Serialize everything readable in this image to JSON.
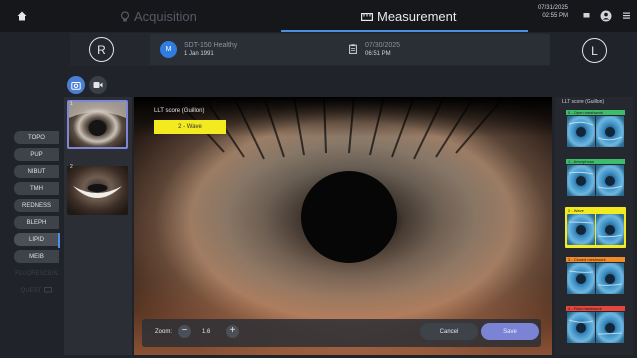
{
  "topbar": {
    "tab_acquisition": "Acquisition",
    "tab_measurement": "Measurement",
    "date": "07/31/2025",
    "time": "02:55 PM"
  },
  "patient": {
    "left_eye_letter": "R",
    "right_eye_letter": "L",
    "avatar_letter": "M",
    "name": "SDT-150 Healthy",
    "dob": "1 Jan 1991",
    "session_date": "07/30/2025",
    "session_time": "06:51 PM"
  },
  "nav": {
    "items": [
      {
        "label": "TOPO",
        "state": "normal"
      },
      {
        "label": "PUP",
        "state": "normal"
      },
      {
        "label": "NIBUT",
        "state": "normal"
      },
      {
        "label": "TMH",
        "state": "normal"
      },
      {
        "label": "REDNESS",
        "state": "normal"
      },
      {
        "label": "BLEPH",
        "state": "normal"
      },
      {
        "label": "LIPID",
        "state": "active"
      },
      {
        "label": "MEIB",
        "state": "normal"
      },
      {
        "label": "FLUORESCEIN",
        "state": "disabled"
      },
      {
        "label": "QUEST",
        "state": "disabled"
      }
    ]
  },
  "thumbnails": {
    "items": [
      {
        "index": "1"
      },
      {
        "index": "2"
      }
    ]
  },
  "main": {
    "llt_title": "LLT score (Guillon)",
    "llt_value": "2 - Wave",
    "zoom_label": "Zoom:",
    "zoom_value": "1.6",
    "zoom_minus": "−",
    "zoom_plus": "+",
    "cancel_label": "Cancel",
    "save_label": "Save"
  },
  "score_panel": {
    "title": "LLT score (Guillon)",
    "grades": [
      {
        "label": "0 - Open meshwork",
        "color": "#3dbd6b",
        "selected": false
      },
      {
        "label": "1 - Amorphous",
        "color": "#3dbd6b",
        "selected": false
      },
      {
        "label": "2 - Wave",
        "color": "#f3ea1f",
        "selected": true
      },
      {
        "label": "3 - Closed meshwork",
        "color": "#f08a2a",
        "selected": false
      },
      {
        "label": "4 - Fluid meshwork",
        "color": "#e5473d",
        "selected": false
      }
    ]
  },
  "colors": {
    "accent": "#4a8fe0",
    "save": "#7b83d4",
    "selected_grade": "#f3ea1f"
  }
}
